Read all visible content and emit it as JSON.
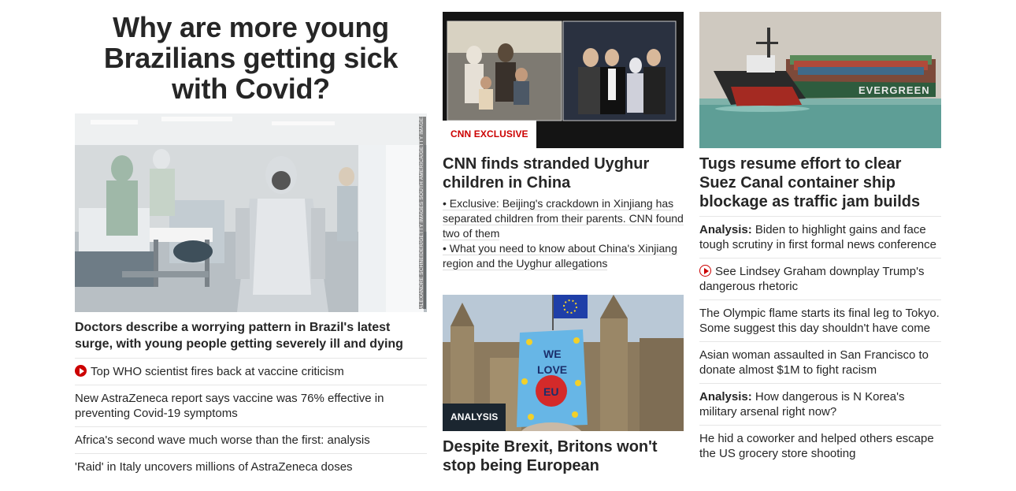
{
  "col1": {
    "headline": "Why are more young Brazilians getting sick with Covid?",
    "image_credit": "ALEXANDRE SCHNEIDER/GETTY IMAGES SOUTH AMERICA/GETTY IMAGES",
    "caption": "Doctors describe a worrying pattern in Brazil's latest surge, with young people getting severely ill and dying",
    "items": [
      {
        "text": "Top WHO scientist fires back at vaccine criticism",
        "video": true
      },
      {
        "text": "New AstraZeneca report says vaccine was 76% effective in preventing Covid-19 symptoms"
      },
      {
        "text": "Africa's second wave much worse than the first: analysis"
      },
      {
        "text": "'Raid' in Italy uncovers millions of AstraZeneca doses"
      }
    ]
  },
  "col2": {
    "story1": {
      "badge": "CNN EXCLUSIVE",
      "headline": "CNN finds stranded Uyghur children in China",
      "bullets": [
        "• Exclusive: Beijing's crackdown in Xinjiang has separated children from their parents. CNN found two of them",
        "• What you need to know about China's Xinjiang region and the Uyghur allegations"
      ]
    },
    "story2": {
      "badge": "ANALYSIS",
      "headline": "Despite Brexit, Britons won't stop being European",
      "sign_line1": "WE",
      "sign_line2": "LOVE",
      "sign_heart": "EU"
    }
  },
  "col3": {
    "ship_name": "EVERGREEN",
    "headline": "Tugs resume effort to clear Suez Canal container ship blockage as traffic jam builds",
    "items": [
      {
        "label": "Analysis:",
        "text": " Biden to highlight gains and face tough scrutiny in first formal news conference"
      },
      {
        "text": "See Lindsey Graham downplay Trump's dangerous rhetoric",
        "video": true
      },
      {
        "text": "The Olympic flame starts its final leg to Tokyo. Some suggest this day shouldn't have come"
      },
      {
        "text": "Asian woman assaulted in San Francisco to donate almost $1M to fight racism"
      },
      {
        "label": "Analysis:",
        "text": " How dangerous is N Korea's military arsenal right now?"
      },
      {
        "text": "He hid a coworker and helped others escape the US grocery store shooting"
      }
    ]
  },
  "colors": {
    "accent_red": "#cc0000",
    "text": "#262626",
    "divider": "#e6e6e6",
    "dark_badge": "#1b2630"
  }
}
